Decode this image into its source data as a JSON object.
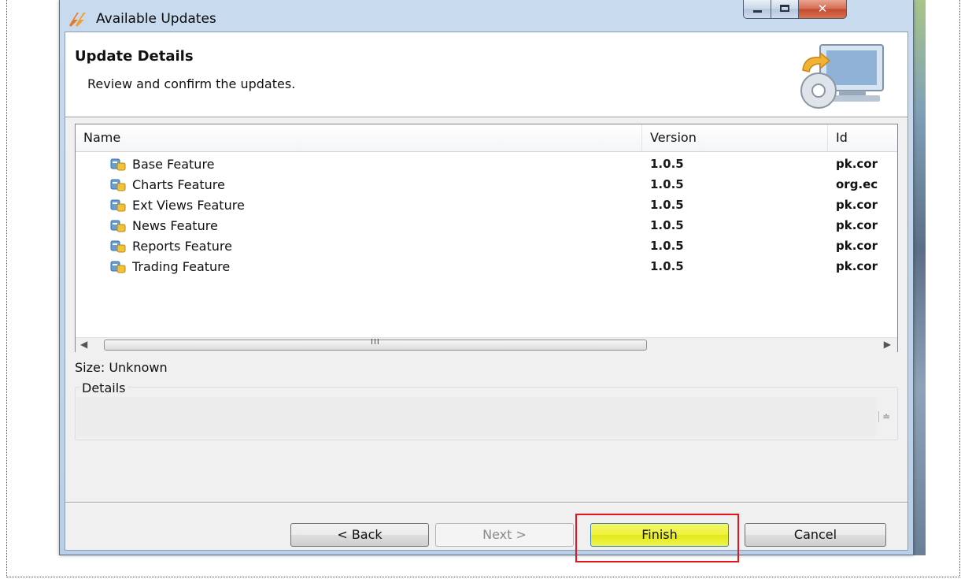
{
  "window": {
    "title": "Available Updates",
    "close_glyph": "✕"
  },
  "banner": {
    "title": "Update Details",
    "description": "Review and confirm the updates."
  },
  "table": {
    "columns": [
      "Name",
      "Version",
      "Id"
    ],
    "rows": [
      {
        "name": "Base Feature",
        "version": "1.0.5",
        "id": "pk.cor"
      },
      {
        "name": "Charts Feature",
        "version": "1.0.5",
        "id": "org.ec"
      },
      {
        "name": "Ext Views Feature",
        "version": "1.0.5",
        "id": "pk.cor"
      },
      {
        "name": "News Feature",
        "version": "1.0.5",
        "id": "pk.cor"
      },
      {
        "name": "Reports Feature",
        "version": "1.0.5",
        "id": "pk.cor"
      },
      {
        "name": "Trading Feature",
        "version": "1.0.5",
        "id": "pk.cor"
      }
    ],
    "scroll_grip": "III",
    "scroll_left_glyph": "◀",
    "scroll_right_glyph": "▶"
  },
  "size": {
    "label": "Size: Unknown"
  },
  "details": {
    "legend": "Details",
    "spin_glyph": "≐"
  },
  "buttons": {
    "back": "< Back",
    "next": "Next >",
    "finish": "Finish",
    "cancel": "Cancel"
  },
  "colors": {
    "finish_highlight": "#e8141c",
    "finish_button": "#eef23a",
    "title_bar": "#c9dbee"
  },
  "icons": {
    "app": "eclipse-lightning-icon",
    "banner": "computer-cd-update-icon",
    "feature": "feature-plugin-icon"
  }
}
